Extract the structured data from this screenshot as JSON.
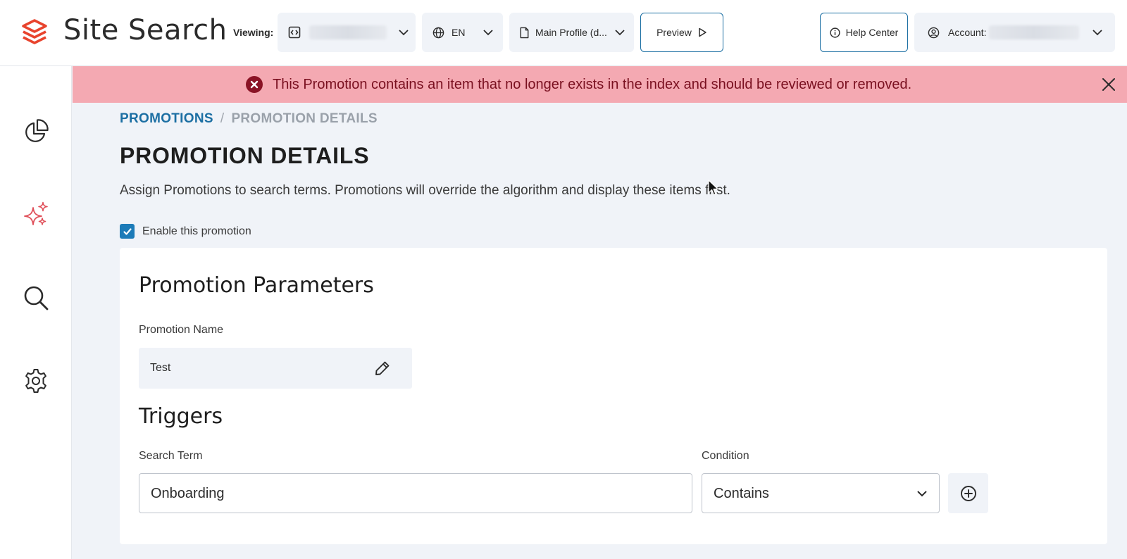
{
  "header": {
    "app_title": "Site Search",
    "viewing_label": "Viewing:",
    "language": "EN",
    "profile": "Main Profile (d...",
    "preview_label": "Preview",
    "help_label": "Help Center",
    "account_label": "Account:"
  },
  "alert": {
    "message": "This Promotion contains an item that no longer exists in the index and should be reviewed or removed.",
    "background": "#f4a9b2",
    "text_color": "#7a1020"
  },
  "breadcrumb": {
    "parent": "PROMOTIONS",
    "separator": "/",
    "current": "PROMOTION DETAILS"
  },
  "page": {
    "title": "PROMOTION DETAILS",
    "description": "Assign Promotions to search terms. Promotions will override the algorithm and display these items first.",
    "enable_label": "Enable this promotion",
    "enabled": true
  },
  "parameters": {
    "heading": "Promotion Parameters",
    "name_label": "Promotion Name",
    "name_value": "Test"
  },
  "triggers": {
    "heading": "Triggers",
    "search_term_label": "Search Term",
    "search_term_value": "Onboarding",
    "condition_label": "Condition",
    "condition_value": "Contains"
  },
  "sidebar": {
    "items": [
      {
        "icon": "analytics-pie-icon"
      },
      {
        "icon": "sparkles-icon",
        "active": true
      },
      {
        "icon": "search-icon"
      },
      {
        "icon": "settings-gear-icon"
      }
    ]
  },
  "colors": {
    "accent": "#1c6fa3",
    "brand": "#e8432d",
    "active_icon": "#e0505a"
  }
}
